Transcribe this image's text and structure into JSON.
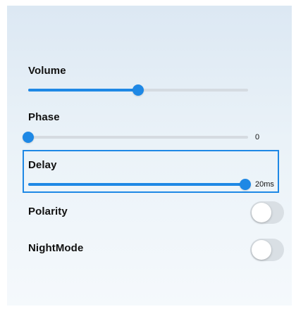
{
  "colors": {
    "accent": "#1e88e5",
    "track": "#d5dbe1",
    "toggle_off": "#d9dfe4",
    "focus_outline": "#1e88e5"
  },
  "settings": {
    "volume": {
      "label": "Volume",
      "level": 0.5,
      "value_text": ""
    },
    "phase": {
      "label": "Phase",
      "level": 0,
      "value_text": "0"
    },
    "delay": {
      "label": "Delay",
      "level": 1,
      "value_text": "20ms",
      "focused": true
    },
    "polarity": {
      "label": "Polarity",
      "on": false
    },
    "nightmode": {
      "label": "NightMode",
      "on": false
    }
  }
}
